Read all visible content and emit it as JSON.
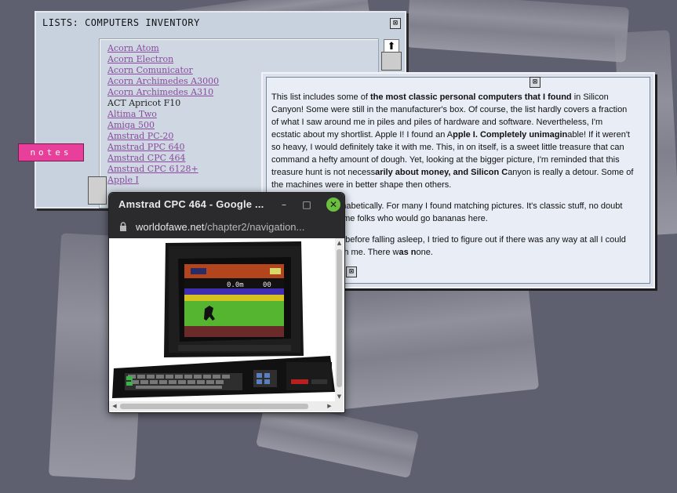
{
  "list_window": {
    "title": "LISTS: COMPUTERS INVENTORY",
    "close_glyph": "⊠",
    "items": [
      {
        "label": "Acorn Atom",
        "link": true
      },
      {
        "label": "Acorn Electron",
        "link": true
      },
      {
        "label": "Acorn Comunicator",
        "link": true
      },
      {
        "label": "Acorn Archimedes A3000",
        "link": true
      },
      {
        "label": "Acorn Archimedes A310",
        "link": true
      },
      {
        "label": "ACT Apricot F10",
        "link": false
      },
      {
        "label": "Altima Two",
        "link": true
      },
      {
        "label": "Amiga 500",
        "link": true
      },
      {
        "label": "Amstrad PC-20",
        "link": true
      },
      {
        "label": "Amstrad PPC 640",
        "link": true
      },
      {
        "label": "Amstrad CPC 464",
        "link": true
      },
      {
        "label": "Amstrad CPC 6128+",
        "link": true
      },
      {
        "label": "Apple I",
        "link": true
      }
    ]
  },
  "notes_tab": {
    "label": "notes"
  },
  "text_window": {
    "close_glyph": "⊠",
    "p1_parts": [
      {
        "t": "This list includes some of ",
        "b": false
      },
      {
        "t": "the most classic personal computers that I found",
        "b": true
      },
      {
        "t": " in Silicon Canyon! Some were still in the manufacturer's box. Of course, the list hardly covers a fraction of what I saw around me in piles and piles of hardware and software. Nevertheless, I'm ecstatic about my shortlist. Apple I! I found an A",
        "b": false
      },
      {
        "t": "pple I. Completely unimagin",
        "b": true
      },
      {
        "t": "able! If it weren't so heavy, I would definitely take it with me. This, in on itself, is a sweet little treasure that can command a hefty amount of dough. Yet, looking at the bigger picture, I'm reminded that this treasure hunt is not necess",
        "b": false
      },
      {
        "t": "arily about money, and Silicon C",
        "b": true
      },
      {
        "t": "anyon is really a detour. Some of the machines were in better shape then others.",
        "b": false
      }
    ],
    "p2_parts": [
      {
        "t": "I sorted the list alphabetically. For many I found matching pictures. It's classic stuff, no doubt about that. I bet some folks who would go bananas here.",
        "b": false
      }
    ],
    "p3_parts": [
      {
        "t": "Later that evening, before falling asleep, I tried to figure out if there was any way at all I could take the Apple I with me. There w",
        "b": false
      },
      {
        "t": "as n",
        "b": true
      },
      {
        "t": "one.",
        "b": false
      }
    ]
  },
  "popup": {
    "title": "Amstrad CPC 464 - Google ...",
    "url_domain": "worldofawe.net",
    "url_path": "/chapter2/navigation...",
    "minimize_glyph": "–",
    "maximize_glyph": "□",
    "close_glyph": "✕",
    "screen_score": "0.0m",
    "screen_time": "00"
  }
}
